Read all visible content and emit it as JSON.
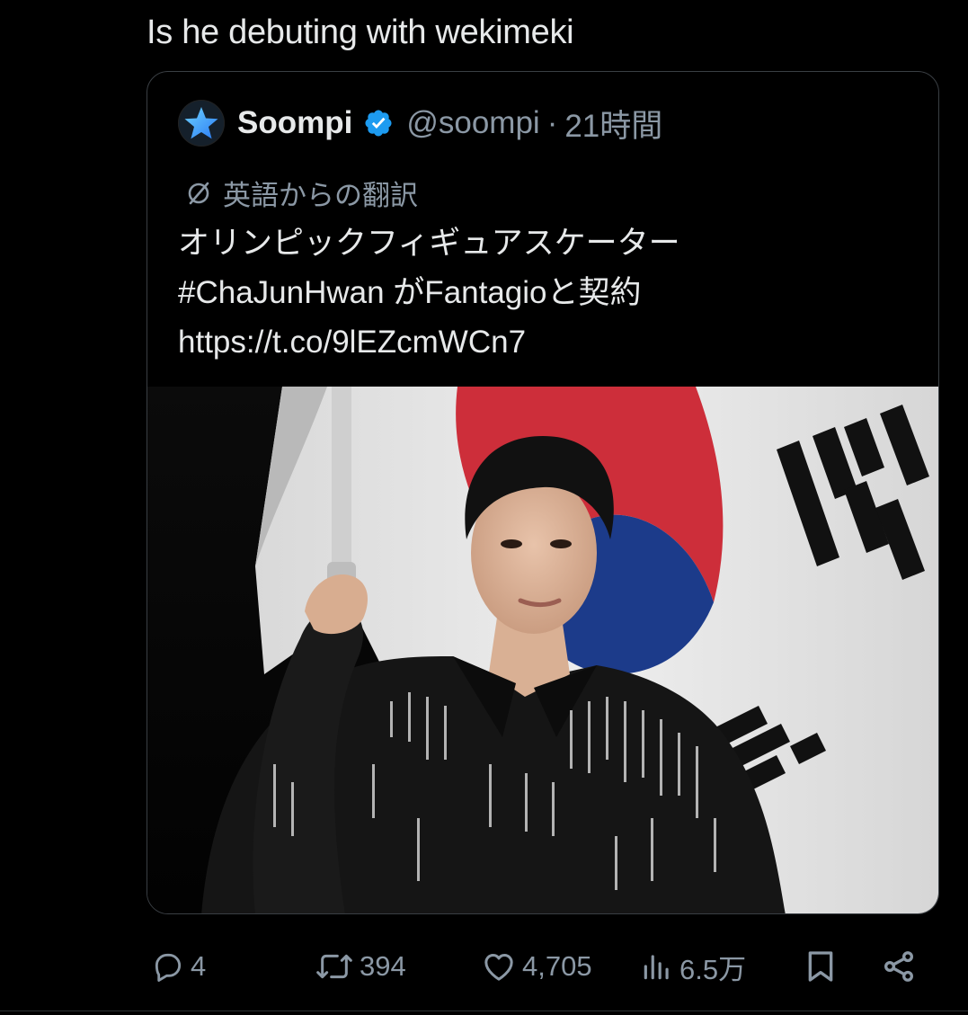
{
  "tweet": {
    "text": "Is he debuting with wekimeki"
  },
  "quote": {
    "name": "Soompi",
    "verified": true,
    "handle": "@soompi",
    "separator": "·",
    "time": "21時間",
    "translation_label": "英語からの翻訳",
    "body_lines": [
      "オリンピックフィギュアスケーター",
      "#ChaJunHwan がFantagioと契約",
      "https://t.co/9lEZcmWCn7"
    ],
    "media": {
      "icons": [
        "korean-flag",
        "person-photo"
      ]
    }
  },
  "actions": {
    "reply_count": "4",
    "retweet_count": "394",
    "like_count": "4,705",
    "view_count": "6.5万"
  },
  "colors": {
    "background": "#000000",
    "text": "#e7e9ea",
    "muted": "#8b98a5",
    "verified": "#1d9bf0",
    "border": "#3a3f44"
  }
}
